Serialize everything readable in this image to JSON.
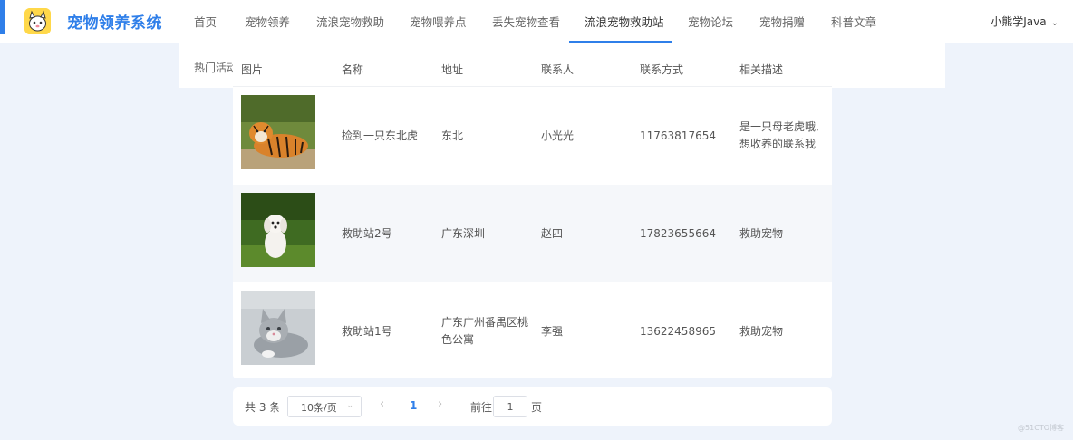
{
  "brand": {
    "title": "宠物领养系统"
  },
  "nav": {
    "items": [
      "首页",
      "宠物领养",
      "流浪宠物救助",
      "宠物喂养点",
      "丢失宠物查看",
      "流浪宠物救助站",
      "宠物论坛",
      "宠物捐赠",
      "科普文章"
    ],
    "active_index": 5
  },
  "user": {
    "name": "小熊学Java"
  },
  "subbar": {
    "hot_label": "热门活动"
  },
  "table": {
    "headers": [
      "图片",
      "名称",
      "地址",
      "联系人",
      "联系方式",
      "相关描述"
    ],
    "rows": [
      {
        "image": "tiger-photo",
        "name": "捡到一只东北虎",
        "address": "东北",
        "contact": "小光光",
        "phone": "11763817654",
        "desc_line1": "是一只母老虎哦,",
        "desc_line2": "想收养的联系我"
      },
      {
        "image": "white-puppy-photo",
        "name": "救助站2号",
        "address": "广东深圳",
        "contact": "赵四",
        "phone": "17823655664",
        "desc_line1": "救助宠物",
        "desc_line2": ""
      },
      {
        "image": "gray-kitten-photo",
        "name": "救助站1号",
        "address_line1": "广东广州番禺区桃",
        "address_line2": "色公寓",
        "contact": "李强",
        "phone": "13622458965",
        "desc_line1": "救助宠物",
        "desc_line2": ""
      }
    ]
  },
  "pager": {
    "total": "共 3 条",
    "page_size": "10条/页",
    "current_page": "1",
    "goto_label": "前往",
    "goto_value": "1",
    "page_unit": "页"
  },
  "watermark": "@51CTO博客"
}
